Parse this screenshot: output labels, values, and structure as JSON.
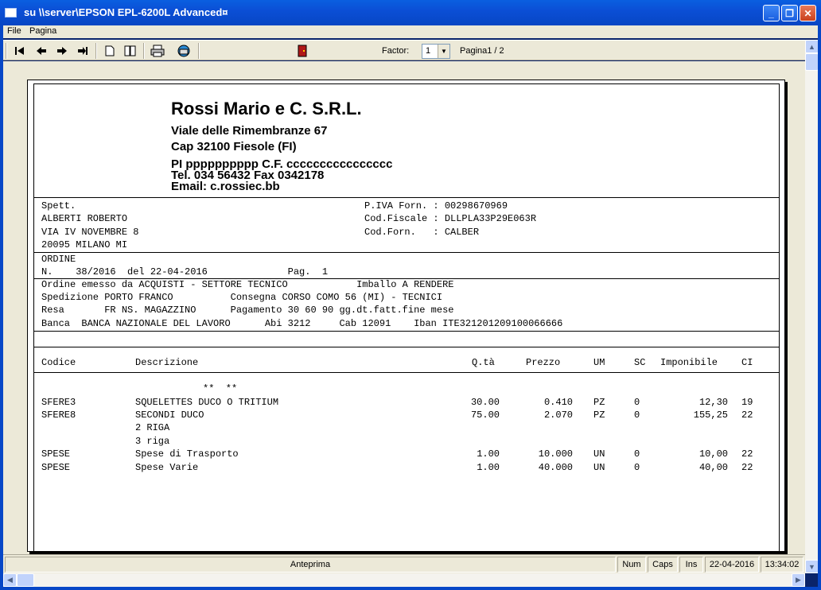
{
  "window": {
    "title": "su \\\\server\\EPSON EPL-6200L Advanced¤",
    "minimize": "_",
    "maximize": "❐",
    "close": "✕"
  },
  "menu": [
    "File",
    "Pagina"
  ],
  "toolbar": {
    "factor_label": "Factor:",
    "factor_value": "1",
    "page_indicator": "Pagina1 / 2",
    "icons": [
      "first-page-icon",
      "previous-page-icon",
      "next-page-icon",
      "last-page-icon",
      "single-page-icon",
      "two-pages-icon",
      "print-icon",
      "printer-setup-icon",
      "exit-icon"
    ]
  },
  "document": {
    "company": {
      "name": "Rossi Mario e C. S.R.L.",
      "address": "Viale delle Rimembranze 67",
      "city": "Cap 32100 Fiesole  (FI)",
      "piva": "PI pppppppppp  C.F. cccccccccccccccc",
      "tel": "Tel. 034 56432  Fax 0342178",
      "email": "Email: c.rossiec.bb"
    },
    "recipient": {
      "line1": "Spett.",
      "line2": "ALBERTI ROBERTO",
      "line3": "VIA IV NOVEMBRE 8",
      "line4": "20095 MILANO MI"
    },
    "supplier": {
      "line1": "P.IVA Forn. : 00298670969",
      "line2": "Cod.Fiscale : DLLPLA33P29E063R",
      "line3": "Cod.Forn.   : CALBER"
    },
    "order": {
      "label": "ORDINE",
      "line": "N.    38/2016  del 22-04-2016              Pag.  1"
    },
    "details": {
      "line1": "Ordine emesso da ACQUISTI - SETTORE TECNICO            Imballo A RENDERE",
      "line2": "Spedizione PORTO FRANCO          Consegna CORSO COMO 56 (MI) - TECNICI",
      "line3": "Resa       FR NS. MAGAZZINO      Pagamento 30 60 90 gg.dt.fatt.fine mese",
      "line4": "Banca  BANCA NAZIONALE DEL LAVORO      Abi 3212     Cab 12091    Iban ITE321201209100066666"
    },
    "columns": {
      "codice": "Codice",
      "descrizione": "Descrizione",
      "qta": "Q.tà",
      "prezzo": "Prezzo",
      "um": "UM",
      "sc": "SC",
      "imponibile": "Imponibile",
      "ci": "CI"
    },
    "stars": "**  **",
    "rows": [
      {
        "codice": "SFERE3",
        "descrizione": "SQUELETTES DUCO O TRITIUM",
        "qta": "30.00",
        "prezzo": "0.410",
        "um": "PZ",
        "sc": "0",
        "imponibile": "12,30",
        "ci": "19"
      },
      {
        "codice": "SFERE8",
        "descrizione": "SECONDI DUCO",
        "qta": "75.00",
        "prezzo": "2.070",
        "um": "PZ",
        "sc": "0",
        "imponibile": "155,25",
        "ci": "22"
      },
      {
        "codice": "",
        "descrizione": "2 RIGA",
        "qta": "",
        "prezzo": "",
        "um": "",
        "sc": "",
        "imponibile": "",
        "ci": ""
      },
      {
        "codice": "",
        "descrizione": "3 riga",
        "qta": "",
        "prezzo": "",
        "um": "",
        "sc": "",
        "imponibile": "",
        "ci": ""
      },
      {
        "codice": "SPESE",
        "descrizione": "Spese di Trasporto",
        "qta": "1.00",
        "prezzo": "10.000",
        "um": "UN",
        "sc": "0",
        "imponibile": "10,00",
        "ci": "22"
      },
      {
        "codice": "SPESE",
        "descrizione": "Spese Varie",
        "qta": "1.00",
        "prezzo": "40.000",
        "um": "UN",
        "sc": "0",
        "imponibile": "40,00",
        "ci": "22"
      }
    ]
  },
  "status": {
    "mode": "Anteprima",
    "num": "Num",
    "caps": "Caps",
    "ins": "Ins",
    "date": "22-04-2016",
    "time": "13:34:02"
  }
}
